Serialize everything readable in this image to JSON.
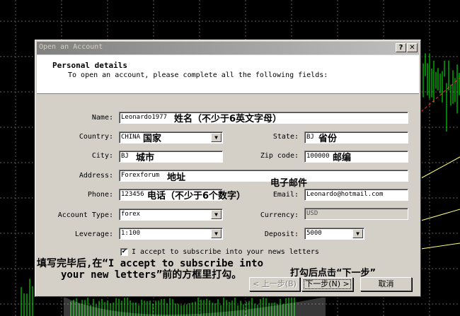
{
  "dialog": {
    "title": "Open an Account",
    "help_btn": "?",
    "close_btn": "✕",
    "header_title": "Personal details",
    "header_subtitle": "To open an account, please complete all the following fields:"
  },
  "form": {
    "name_label": "Name:",
    "name_value": "Leonardo1977",
    "name_note": "姓名（不少于6英文字母）",
    "country_label": "Country:",
    "country_value": "CHINA",
    "country_note": "国家",
    "state_label": "State:",
    "state_value": "BJ",
    "state_note": "省份",
    "city_label": "City:",
    "city_value": "BJ",
    "city_note": "城市",
    "zip_label": "Zip code:",
    "zip_value": "100000",
    "zip_note": "邮编",
    "address_label": "Address:",
    "address_value": "Forexforum",
    "address_note": "地址",
    "email_note": "电子邮件",
    "phone_label": "Phone:",
    "phone_value": "123456",
    "phone_note": "电话（不少于6个数字）",
    "email_label": "Email:",
    "email_value": "Leonardo@hotmail.com",
    "account_type_label": "Account Type:",
    "account_type_value": "forex",
    "currency_label": "Currency:",
    "currency_value": "USD",
    "leverage_label": "Leverage:",
    "leverage_value": "1:100",
    "deposit_label": "Deposit:",
    "deposit_value": "5000",
    "subscribe_checked": "✔",
    "subscribe_label": "I accept to subscribe into your news letters"
  },
  "instructions": {
    "line1": "填写完毕后,在“I accept to subscribe into",
    "line2": "your new letters”前的方框里打勾。",
    "next_hint": "打勾后点击“下一步”"
  },
  "buttons": {
    "back": "< 上一步(B)",
    "next": "下一步(N) >",
    "cancel": "取消"
  },
  "colors": {
    "chart_bars": "#00ff00",
    "chart_lines": "#ffff80",
    "trend_line": "#ff3030",
    "grid": "#606060"
  }
}
